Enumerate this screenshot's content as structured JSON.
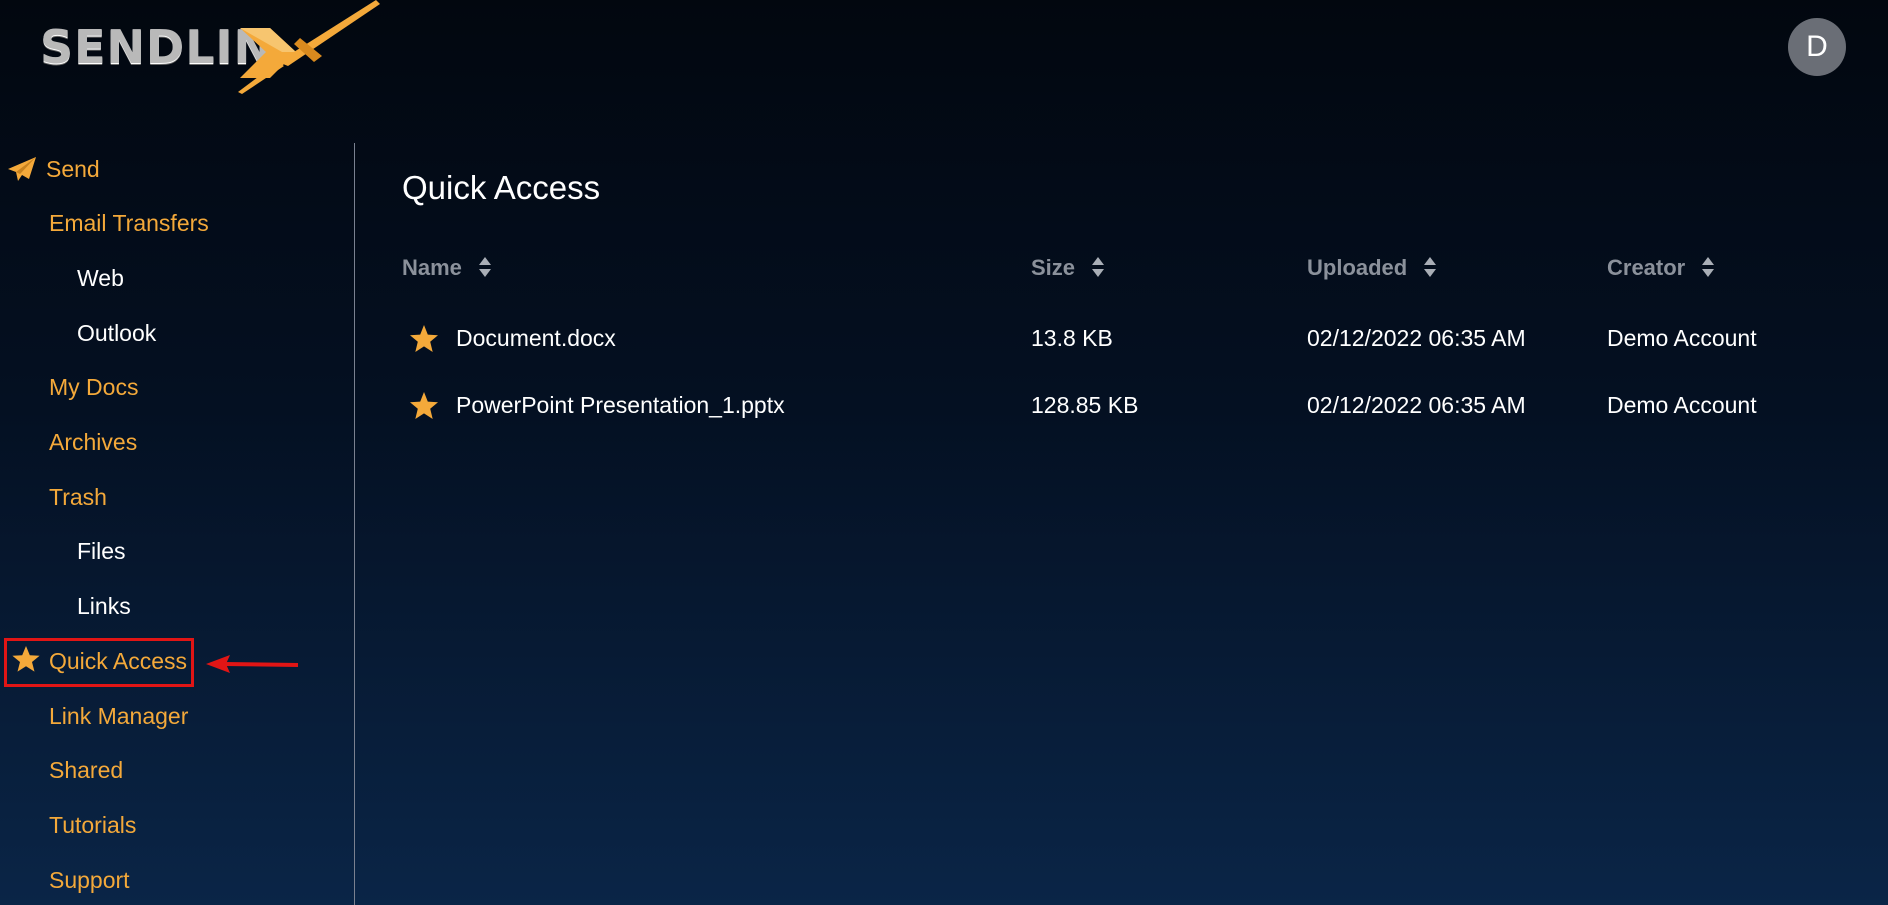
{
  "brand": {
    "logo_text": "SENDLIN",
    "logo_accent_color": "#f4a93a"
  },
  "user": {
    "avatar_initial": "D"
  },
  "sidebar": {
    "send": {
      "label": "Send",
      "icon": "paper-plane-icon"
    },
    "email_transfers": {
      "label": "Email Transfers"
    },
    "web": {
      "label": "Web"
    },
    "outlook": {
      "label": "Outlook"
    },
    "my_docs": {
      "label": "My Docs"
    },
    "archives": {
      "label": "Archives"
    },
    "trash": {
      "label": "Trash"
    },
    "files": {
      "label": "Files"
    },
    "links": {
      "label": "Links"
    },
    "quick_access": {
      "label": "Quick Access",
      "icon": "star-icon",
      "highlighted": true
    },
    "link_manager": {
      "label": "Link Manager"
    },
    "shared": {
      "label": "Shared"
    },
    "tutorials": {
      "label": "Tutorials"
    },
    "support": {
      "label": "Support"
    }
  },
  "main": {
    "title": "Quick Access",
    "columns": {
      "name": "Name",
      "size": "Size",
      "uploaded": "Uploaded",
      "creator": "Creator"
    },
    "rows": [
      {
        "name": "Document.docx",
        "size": "13.8 KB",
        "uploaded": "02/12/2022 06:35 AM",
        "creator": "Demo Account",
        "starred": true
      },
      {
        "name": "PowerPoint Presentation_1.pptx",
        "size": "128.85 KB",
        "uploaded": "02/12/2022 06:35 AM",
        "creator": "Demo Account",
        "starred": true
      }
    ]
  },
  "colors": {
    "accent": "#f4a93a",
    "annotation": "#e11515",
    "header_text": "#8b919b"
  }
}
